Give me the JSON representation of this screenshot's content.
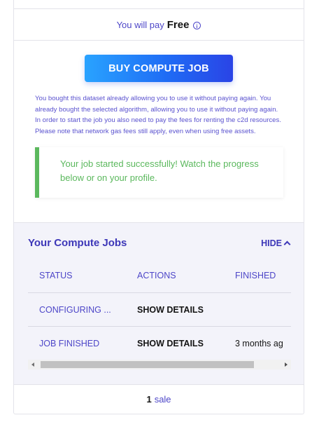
{
  "pricing": {
    "prefix": "You will pay",
    "price": "Free"
  },
  "buy_button": {
    "label": "BUY COMPUTE JOB"
  },
  "notice": {
    "text": "You bought this dataset already allowing you to use it without paying again. You already bought the selected algorithm, allowing you to use it without paying again. In order to start the job you also need to pay the fees for renting the c2d resources. Please note that network gas fees still apply, even when using free assets."
  },
  "alert": {
    "text": "Your job started successfully! Watch the progress below or on your profile.",
    "color": "#5bb85d"
  },
  "jobs": {
    "title": "Your Compute Jobs",
    "toggle_label": "HIDE",
    "toggle_icon": "chevron-up-icon",
    "columns": [
      "STATUS",
      "ACTIONS",
      "FINISHED"
    ],
    "rows": [
      {
        "status": "CONFIGURING ...",
        "action": "SHOW DETAILS",
        "finished": ""
      },
      {
        "status": "JOB FINISHED",
        "action": "SHOW DETAILS",
        "finished": "3 months ag"
      }
    ]
  },
  "sales": {
    "count": "1",
    "label": "sale"
  },
  "colors": {
    "accent": "#4d46c8",
    "button_gradient_start": "#29a3ff",
    "button_gradient_end": "#2a44e6",
    "jobs_background": "#f3f3fa"
  }
}
